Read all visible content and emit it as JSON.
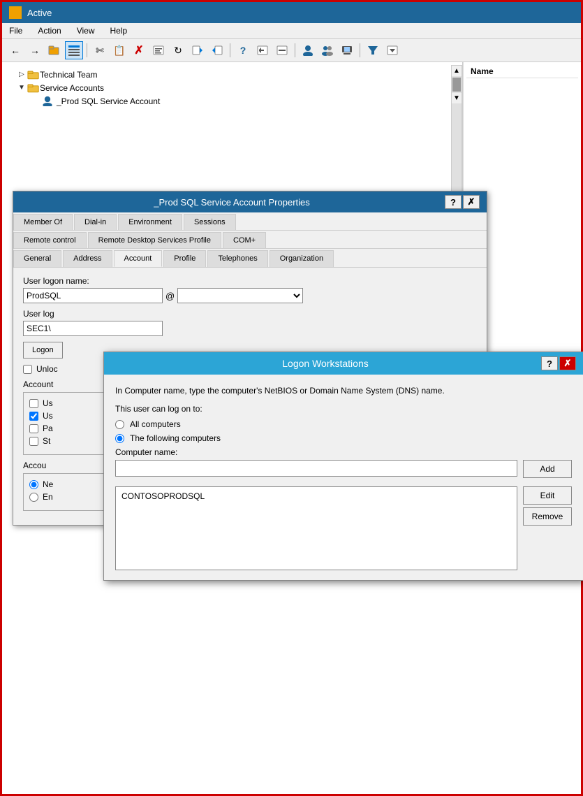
{
  "app": {
    "title": "Active",
    "icon": "folder-icon"
  },
  "menu": {
    "items": [
      "File",
      "Action",
      "View",
      "Help"
    ]
  },
  "toolbar": {
    "buttons": [
      "back",
      "forward",
      "up-folder",
      "detail-view",
      "cut",
      "copy",
      "delete",
      "properties",
      "refresh",
      "export",
      "import",
      "help",
      "zoom-in",
      "zoom-out",
      "user",
      "users",
      "computer",
      "filter",
      "more"
    ]
  },
  "tree": {
    "items": [
      {
        "label": "Technical Team",
        "indent": 1,
        "type": "folder",
        "expander": "▷"
      },
      {
        "label": "Service Accounts",
        "indent": 1,
        "type": "folder",
        "expander": "◢"
      },
      {
        "label": "_Prod SQL Service Account",
        "indent": 2,
        "type": "user",
        "expander": ""
      }
    ]
  },
  "right_panel": {
    "header": "Name"
  },
  "properties_dialog": {
    "title": "_Prod SQL Service Account Properties",
    "tabs_row1": [
      "Member Of",
      "Dial-in",
      "Environment",
      "Sessions"
    ],
    "tabs_row2": [
      "Remote control",
      "Remote Desktop Services Profile",
      "COM+"
    ],
    "tabs_row3": [
      "General",
      "Address",
      "Account",
      "Profile",
      "Telephones",
      "Organization"
    ],
    "active_tab": "Account",
    "fields": {
      "user_logon_label": "User logon name:",
      "user_logon_value": "ProdSQL",
      "user_logon_down_label": "User log",
      "user_logon_down_value": "SEC1\\",
      "logon_btn": "Logon",
      "unlock_label": "Unloc",
      "account_options_label": "Account",
      "checkboxes": [
        {
          "label": "Us",
          "checked": false
        },
        {
          "label": "Us",
          "checked": true
        },
        {
          "label": "Pa",
          "checked": false
        },
        {
          "label": "St",
          "checked": false
        }
      ],
      "account_expires_label": "Accou",
      "radio_options": [
        {
          "label": "Ne",
          "checked": true
        },
        {
          "label": "En",
          "checked": false
        }
      ]
    }
  },
  "logon_workstations_dialog": {
    "title": "Logon Workstations",
    "info_text1": "In Computer name, type the computer's NetBIOS or Domain Name System (DNS) name.",
    "info_text2": "This user can log on to:",
    "radio_all_computers": "All computers",
    "radio_following": "The following computers",
    "computer_name_label": "Computer name:",
    "computer_name_placeholder": "",
    "computers_list": [
      "CONTOSOPRODSQL"
    ],
    "btn_add": "Add",
    "btn_edit": "Edit",
    "btn_remove": "Remove",
    "btn_help": "?",
    "btn_close": "✕"
  }
}
